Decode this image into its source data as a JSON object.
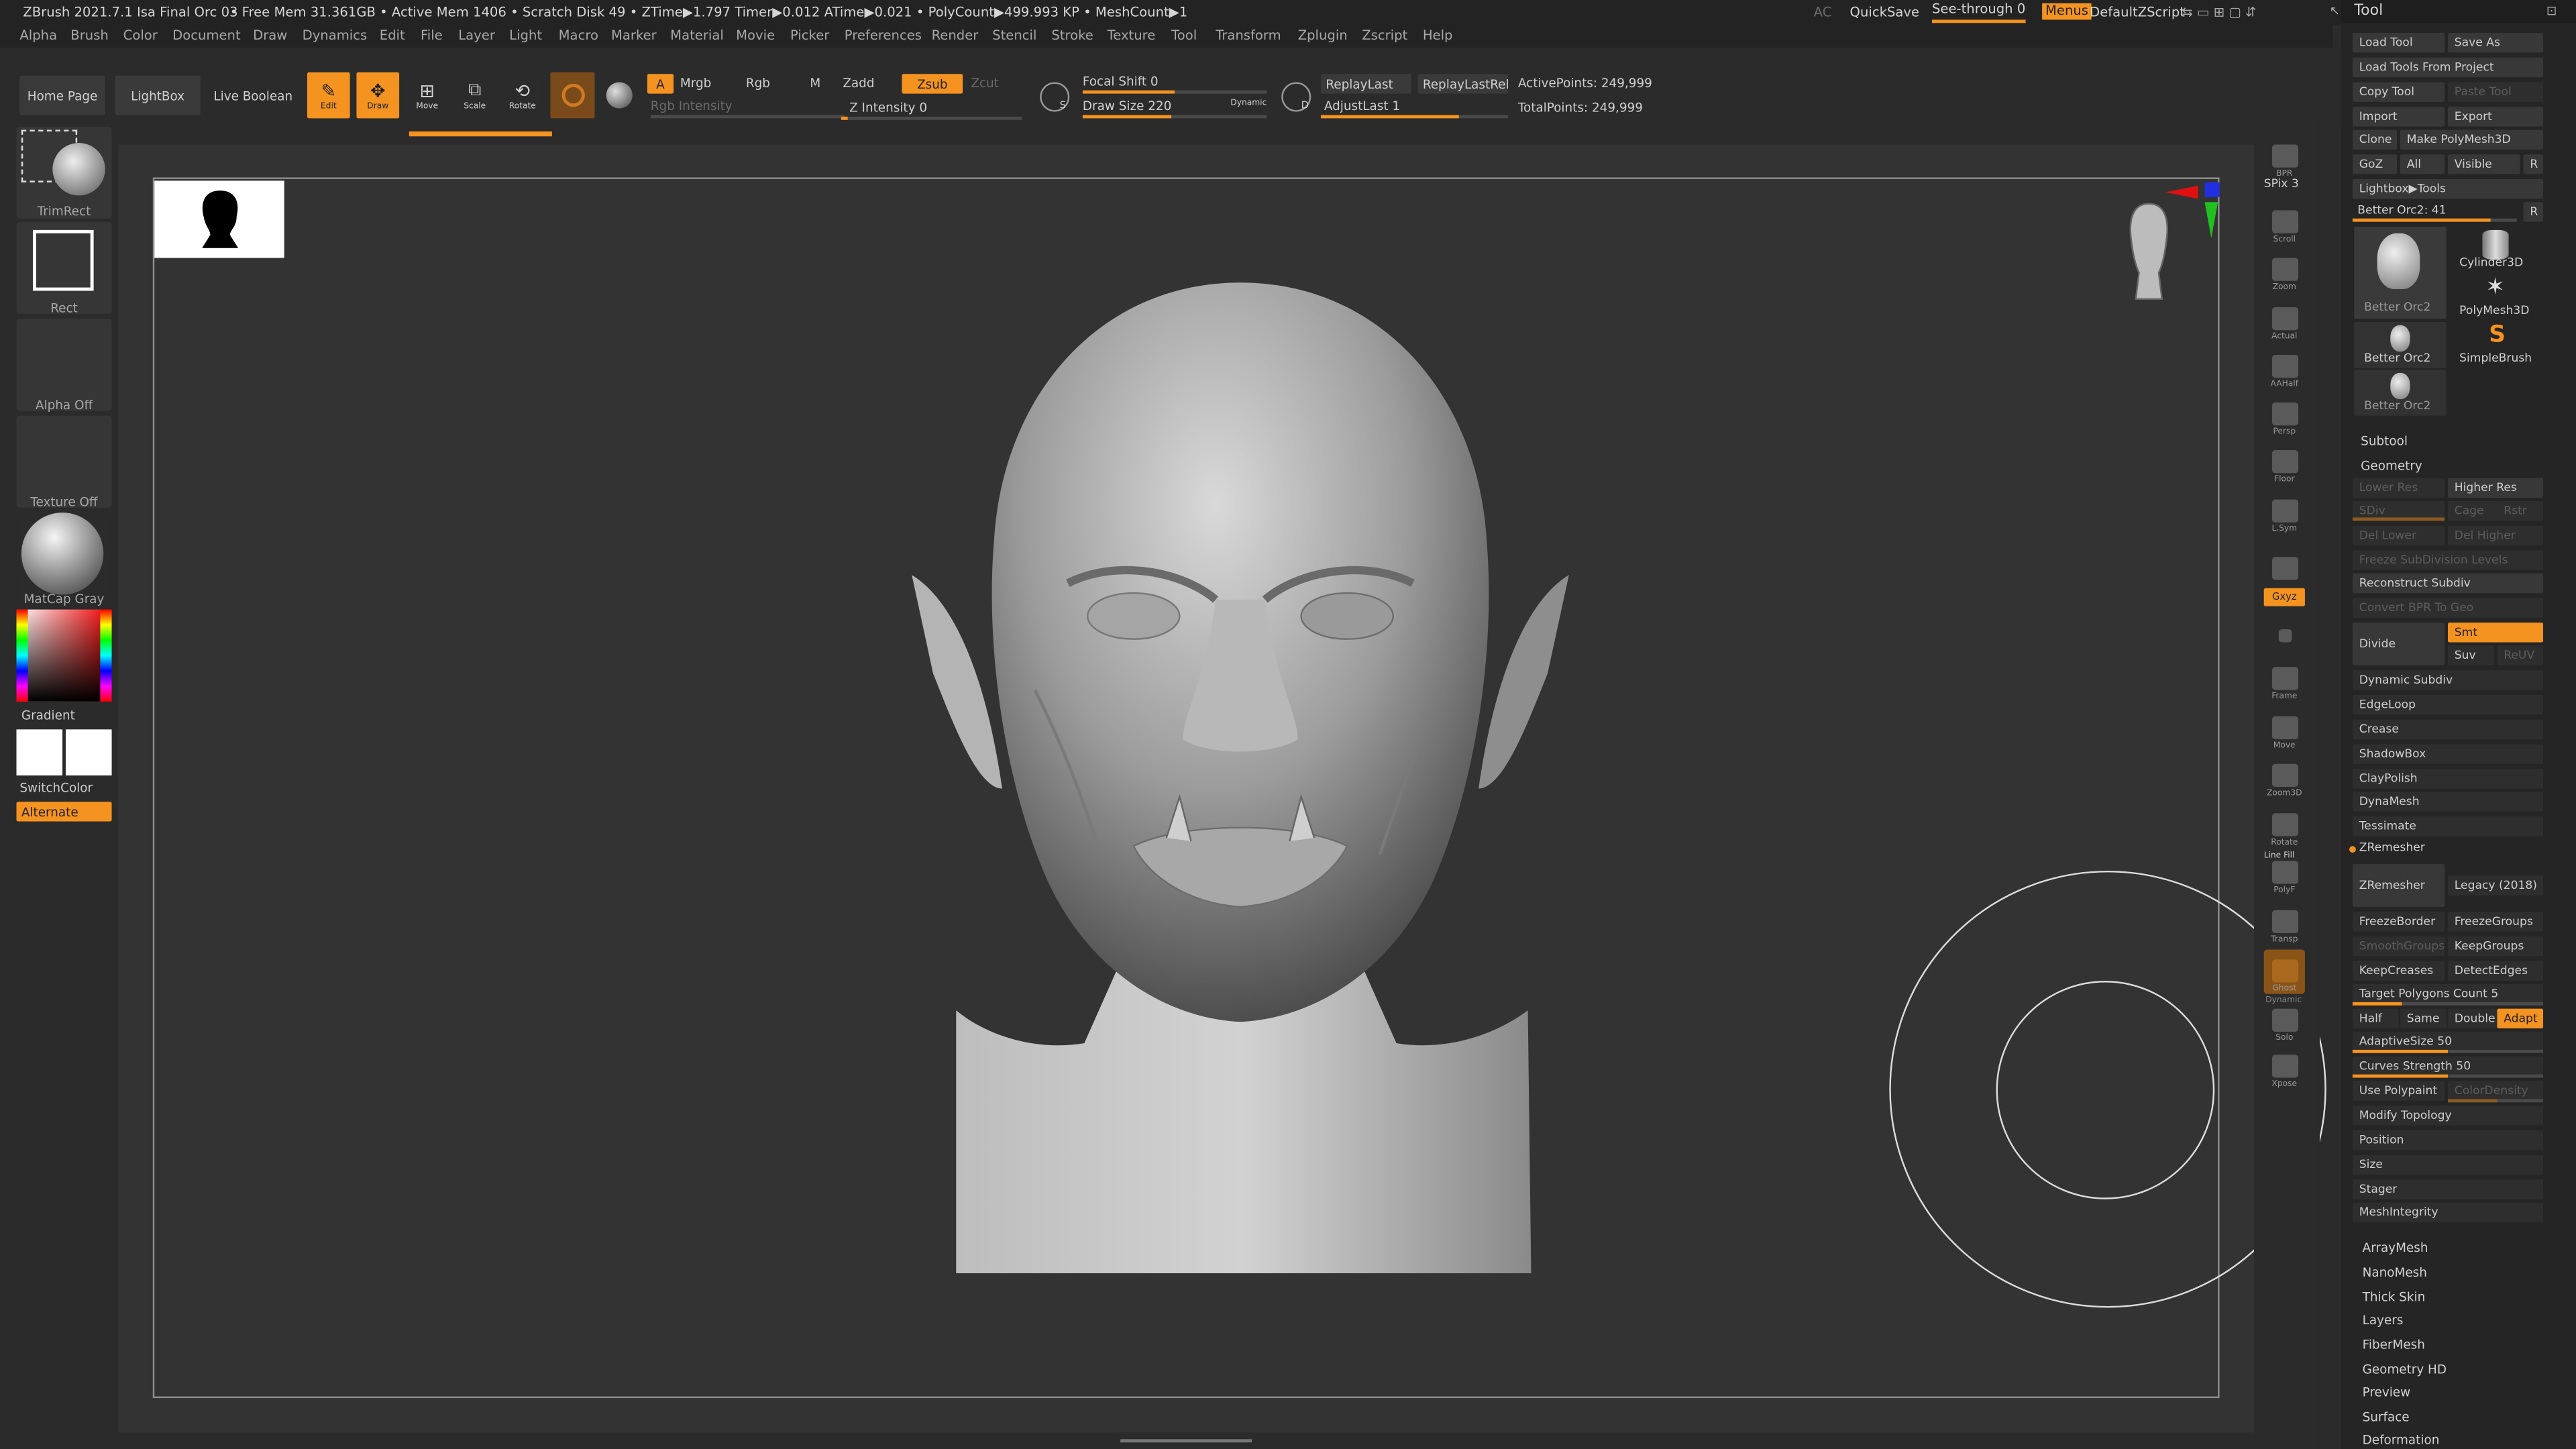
{
  "title_bar": {
    "app": "ZBrush 2021.7.1 Isa Final Orc 03",
    "stats": "• Free Mem 31.361GB • Active Mem 1406 • Scratch Disk 49 • ZTime▶1.797 Timer▶0.012 ATime▶0.021 • PolyCount▶499.993 KP • MeshCount▶1",
    "ac": "AC",
    "quicksave": "QuickSave",
    "see_through": "See-through  0",
    "menus": "Menus",
    "script": "DefaultZScript",
    "tray_title": "Tool"
  },
  "menu": [
    "Alpha",
    "Brush",
    "Color",
    "Document",
    "Draw",
    "Dynamics",
    "Edit",
    "File",
    "Layer",
    "Light",
    "Macro",
    "Marker",
    "Material",
    "Movie",
    "Picker",
    "Preferences",
    "Render",
    "Stencil",
    "Stroke",
    "Texture",
    "Tool",
    "Transform",
    "Zplugin",
    "Zscript",
    "Help"
  ],
  "top": {
    "home": "Home Page",
    "lightbox": "LightBox",
    "live_boolean": "Live Boolean",
    "edit": "Edit",
    "draw": "Draw",
    "move": "Move",
    "scale": "Scale",
    "rotate": "Rotate",
    "a": "A",
    "mrgb": "Mrgb",
    "rgb": "Rgb",
    "m": "M",
    "zadd": "Zadd",
    "zsub": "Zsub",
    "zcut": "Zcut",
    "rgb_intensity": "Rgb Intensity",
    "z_intensity": "Z Intensity 0",
    "focal_shift": "Focal Shift 0",
    "draw_size": "Draw Size 220",
    "dynamic": "Dynamic",
    "s": "S",
    "d": "D",
    "replay_last": "ReplayLast",
    "replay_last_rel": "ReplayLastRel",
    "adjust_last": "AdjustLast 1",
    "active_points": "ActivePoints: 249,999",
    "total_points": "TotalPoints: 249,999"
  },
  "left": {
    "trimrect": "TrimRect",
    "rect": "Rect",
    "alpha": "Alpha Off",
    "texture": "Texture Off",
    "matcap": "MatCap Gray",
    "gradient": "Gradient",
    "switch_color": "SwitchColor",
    "alternate": "Alternate"
  },
  "right_shelf": [
    "BPR",
    "SPix 3",
    "Scroll",
    "Zoom",
    "Actual",
    "AAHalf",
    "Persp",
    "Floor",
    "L.Sym",
    "",
    "Gxyz",
    "",
    "",
    "Frame",
    "Move",
    "Zoom3D",
    "Rotate",
    "Line Fill",
    "PolyF",
    "Transp",
    "Ghost",
    "Dynamic",
    "Solo",
    "Xpose"
  ],
  "tool": {
    "load": "Load Tool",
    "save_as": "Save As",
    "load_proj": "Load Tools From Project",
    "copy": "Copy Tool",
    "paste": "Paste Tool",
    "import": "Import",
    "export": "Export",
    "clone": "Clone",
    "make_poly": "Make PolyMesh3D",
    "goz": "GoZ",
    "all": "All",
    "visible": "Visible",
    "r": "R",
    "lightbox_tools": "Lightbox▶Tools",
    "current": "Better Orc2: 41",
    "r2": "R",
    "thumbs": [
      "Better Orc2",
      "Cylinder3D",
      "PolyMesh3D",
      "Better Orc2",
      "SimpleBrush",
      "Better Orc2"
    ]
  },
  "geometry": {
    "subtool": "Subtool",
    "geometry": "Geometry",
    "lower_res": "Lower Res",
    "higher_res": "Higher Res",
    "sdiv": "SDiv",
    "cage": "Cage",
    "rstr": "Rstr",
    "del_lower": "Del Lower",
    "del_higher": "Del Higher",
    "freeze": "Freeze SubDivision Levels",
    "reconstruct": "Reconstruct Subdiv",
    "convert_bpr": "Convert BPR To Geo",
    "divide": "Divide",
    "smt": "Smt",
    "suv": "Suv",
    "reuv": "ReUV",
    "dynamic_subdiv": "Dynamic Subdiv",
    "edgeloop": "EdgeLoop",
    "crease": "Crease",
    "shadowbox": "ShadowBox",
    "claypolish": "ClayPolish",
    "dynamesh": "DynaMesh",
    "tessimate": "Tessimate",
    "zremesher_hdr": "ZRemesher",
    "zremesher": "ZRemesher",
    "legacy": "Legacy (2018)",
    "freezeborder": "FreezeBorder",
    "freezegroups": "FreezeGroups",
    "smoothgroups": "SmoothGroups",
    "keepgroups": "KeepGroups",
    "keepcreases": "KeepCreases",
    "detectedges": "DetectEdges",
    "target": "Target Polygons Count 5",
    "half": "Half",
    "same": "Same",
    "double": "Double",
    "adapt": "Adapt",
    "adaptive_size": "AdaptiveSize 50",
    "curves_strength": "Curves Strength 50",
    "use_polypaint": "Use Polypaint",
    "color_density": "ColorDensity",
    "modify_topology": "Modify Topology",
    "position": "Position",
    "size": "Size",
    "stager": "Stager",
    "meshintegrity": "MeshIntegrity"
  },
  "sections": [
    "ArrayMesh",
    "NanoMesh",
    "Thick Skin",
    "Layers",
    "FiberMesh",
    "Geometry HD",
    "Preview",
    "Surface",
    "Deformation"
  ]
}
